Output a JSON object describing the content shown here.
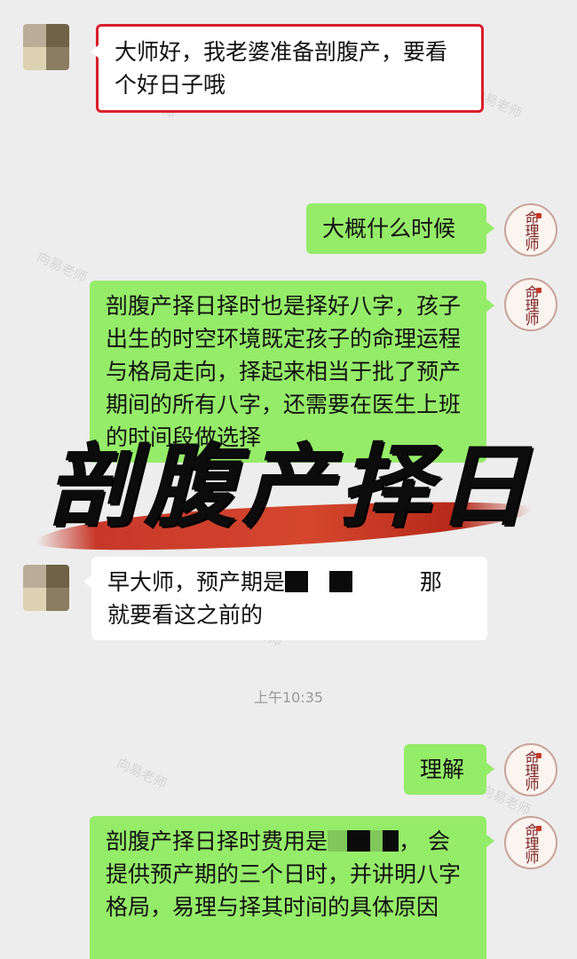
{
  "watermark": "向易老师",
  "messages": {
    "m1": "大师好，我老婆准备剖腹产，要看个好日子哦",
    "m2": "大概什么时候",
    "m3": "剖腹产择日择时也是择好八字，孩子出生的时空环境既定孩子的命理运程与格局走向，择起来相当于批了预产期间的所有八字，还需要在医生上班的时间段做选择",
    "m4a": "早大师，预产期是",
    "m4b": "那",
    "m4c": "就要看这之前的",
    "m5": "理解",
    "m6a": "剖腹产择日择时费用是",
    "m6b": "，",
    "m6c": "会提供预产期的三个日时，并讲明八字格局，易理与择其时间的具体原因"
  },
  "timestamp": "上午10:35",
  "banner": "剖腹产择日",
  "master_avatar": {
    "text": "命理师",
    "color": "#7a1f1f"
  },
  "colors": {
    "bubble_green": "#95ec69",
    "highlight": "#d9202a",
    "background": "#ededed"
  }
}
